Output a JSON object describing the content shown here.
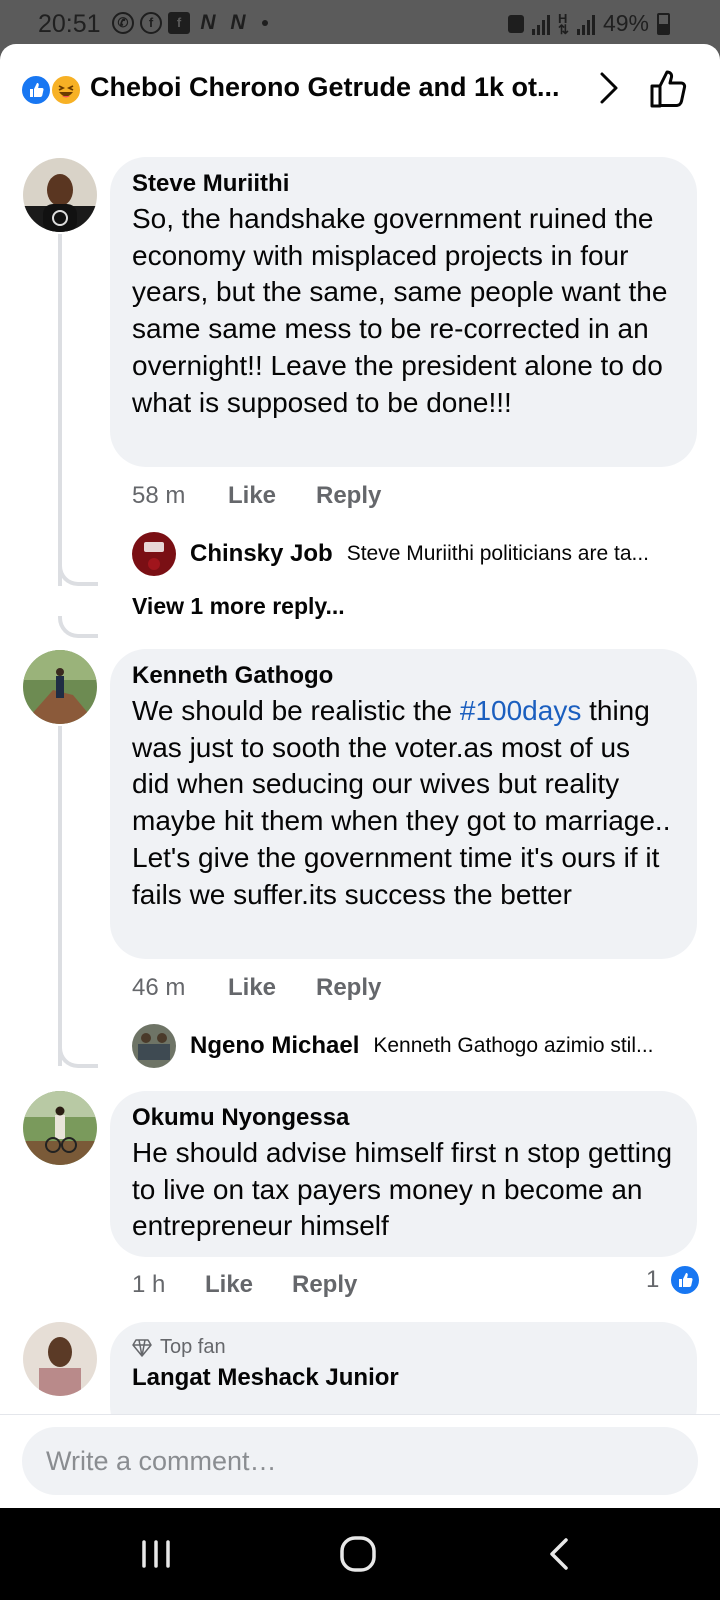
{
  "status_bar": {
    "time": "20:51",
    "battery": "49%",
    "left_icons": [
      "whatsapp-icon",
      "facebook-messenger-icon",
      "facebook-icon",
      "nn-icon",
      "nn-icon",
      "notification-dot"
    ],
    "right_icons": [
      "lock-icon",
      "signal-icon",
      "data-icon",
      "signal-icon",
      "battery-icon"
    ]
  },
  "header": {
    "reactions": [
      "like",
      "haha"
    ],
    "title": "Cheboi Cherono Getrude and 1k ot..."
  },
  "comments": [
    {
      "author": "Steve Muriithi",
      "text": "So, the handshake government ruined the economy with misplaced projects in four years, but the same, same people want the same same mess to be re-corrected in an overnight!! Leave the president alone to do what is supposed to be done!!!",
      "time": "58 m",
      "like_label": "Like",
      "reply_label": "Reply",
      "replies": [
        {
          "author": "Chinsky Job",
          "text": "Steve Muriithi politicians are ta..."
        }
      ],
      "view_more": "View 1 more reply..."
    },
    {
      "author": "Kenneth Gathogo",
      "text_before": "We should be realistic the ",
      "hashtag": "#100days",
      "text_after": " thing was just to sooth the voter.as most of us did when seducing our wives but reality maybe hit them when they got to marriage.. Let's give the government time it's ours if  it fails we suffer.its success the better",
      "time": "46 m",
      "like_label": "Like",
      "reply_label": "Reply",
      "replies": [
        {
          "author": "Ngeno Michael",
          "text": "Kenneth Gathogo azimio stil..."
        }
      ]
    },
    {
      "author": "Okumu Nyongessa",
      "text": "He should advise himself first n stop getting to live on tax payers money n become an entrepreneur himself",
      "time": "1 h",
      "like_label": "Like",
      "reply_label": "Reply",
      "reaction_count": "1"
    },
    {
      "badge": "Top fan",
      "author": "Langat Meshack Junior"
    }
  ],
  "composer": {
    "placeholder": "Write a comment…"
  },
  "colors": {
    "accent": "#1877f2",
    "hashtag": "#1b5fbf",
    "bubble": "#f0f2f5",
    "meta": "#65676b"
  }
}
